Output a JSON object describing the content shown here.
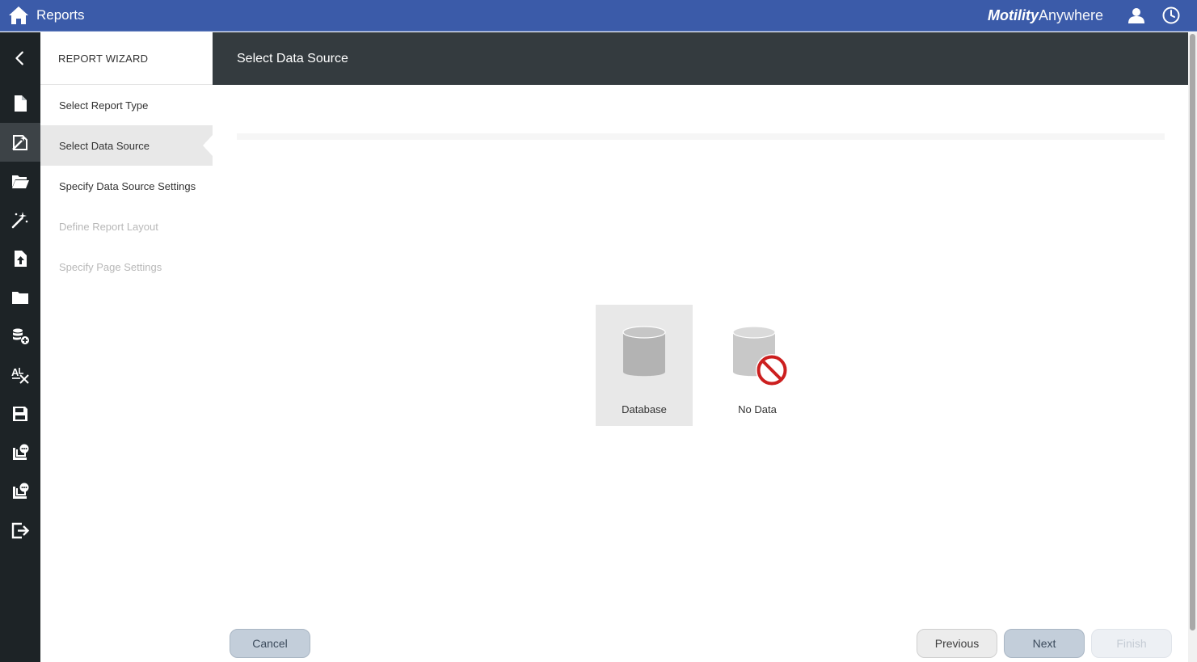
{
  "header": {
    "title": "Reports",
    "brand_bold": "Motility",
    "brand_light": "Anywhere",
    "home_icon": "home-icon",
    "user_icon": "user-icon",
    "clock_icon": "clock-icon",
    "bg_color": "#3b5ba9"
  },
  "rail": {
    "items": [
      {
        "name": "new-report-icon"
      },
      {
        "name": "report-wizard-icon",
        "active": true
      },
      {
        "name": "open-folder-icon"
      },
      {
        "name": "magic-wand-icon"
      },
      {
        "name": "upload-file-icon"
      },
      {
        "name": "folder-icon"
      },
      {
        "name": "add-datasource-icon"
      },
      {
        "name": "localization-icon"
      },
      {
        "name": "save-icon"
      },
      {
        "name": "report-comment-icon"
      },
      {
        "name": "report-comment-alt-icon"
      },
      {
        "name": "exit-icon"
      }
    ]
  },
  "wizard": {
    "heading": "REPORT WIZARD",
    "steps": [
      {
        "label": "Select Report Type",
        "state": "done"
      },
      {
        "label": "Select Data Source",
        "state": "active"
      },
      {
        "label": "Specify Data Source Settings",
        "state": "enabled"
      },
      {
        "label": "Define Report Layout",
        "state": "disabled"
      },
      {
        "label": "Specify Page Settings",
        "state": "disabled"
      }
    ]
  },
  "main": {
    "title": "Select Data Source",
    "options": [
      {
        "label": "Database",
        "icon": "database-icon",
        "selected": true
      },
      {
        "label": "No Data",
        "icon": "no-data-icon",
        "selected": false
      }
    ]
  },
  "buttons": {
    "cancel": "Cancel",
    "previous": "Previous",
    "next": "Next",
    "finish": "Finish"
  }
}
